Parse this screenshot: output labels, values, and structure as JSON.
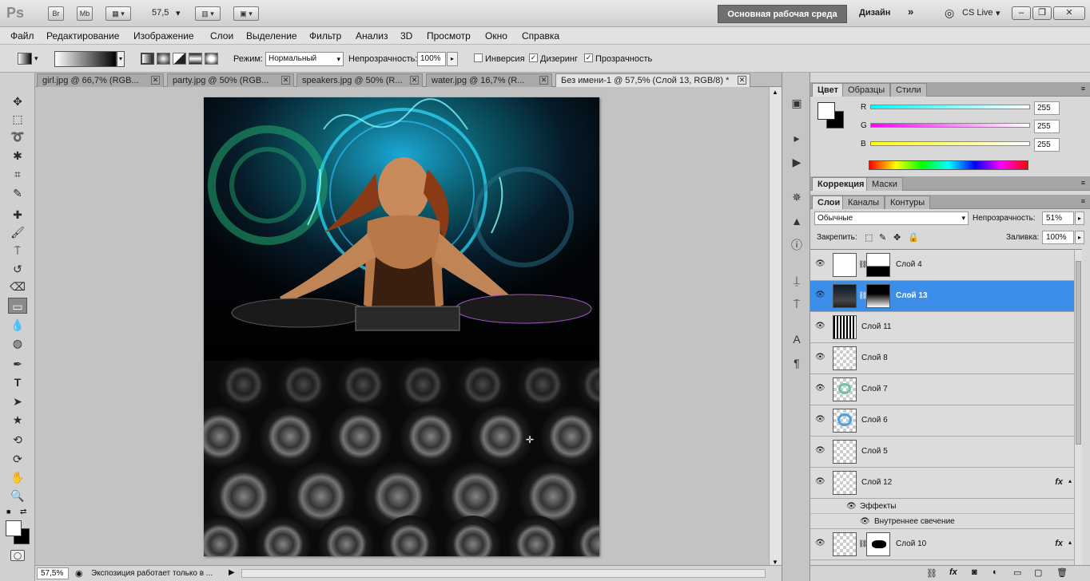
{
  "app": {
    "logo": "Ps",
    "bridge": "Br",
    "minibridge": "Mb",
    "zoom_value": "57,5",
    "workspace": "Основная рабочая среда",
    "design": "Дизайн",
    "more": "»",
    "cslive": "CS Live"
  },
  "window_controls": {
    "minimize": "–",
    "restore": "❐",
    "close": "✕"
  },
  "menu": [
    "Файл",
    "Редактирование",
    "Изображение",
    "Слои",
    "Выделение",
    "Фильтр",
    "Анализ",
    "3D",
    "Просмотр",
    "Окно",
    "Справка"
  ],
  "options": {
    "mode_label": "Режим:",
    "mode_value": "Нормальный",
    "opacity_label": "Непрозрачность:",
    "opacity_value": "100%",
    "invert_label": "Инверсия",
    "dither_label": "Дизеринг",
    "transparency_label": "Прозрачность"
  },
  "doc_tabs": [
    {
      "label": "girl.jpg @ 66,7% (RGB..."
    },
    {
      "label": "party.jpg @ 50% (RGB..."
    },
    {
      "label": "speakers.jpg @ 50% (R..."
    },
    {
      "label": "water.jpg @ 16,7% (R..."
    },
    {
      "label": "Без имени-1 @ 57,5% (Слой 13, RGB/8) *"
    }
  ],
  "status": {
    "zoom": "57,5%",
    "message": "Экспозиция работает только в ..."
  },
  "color_panel": {
    "tabs": [
      "Цвет",
      "Образцы",
      "Стили"
    ],
    "r_label": "R",
    "g_label": "G",
    "b_label": "B",
    "r": "255",
    "g": "255",
    "b": "255"
  },
  "adjust_panel": {
    "tabs": [
      "Коррекция",
      "Маски"
    ]
  },
  "layers_panel": {
    "tabs": [
      "Слои",
      "Каналы",
      "Контуры"
    ],
    "blend_mode": "Обычные",
    "opacity_label": "Непрозрачность:",
    "opacity_value": "51%",
    "lock_label": "Закрепить:",
    "fill_label": "Заливка:",
    "fill_value": "100%",
    "effects_label": "Эффекты",
    "inner_glow_label": "Внутреннее свечение",
    "fx": "fx",
    "layers": [
      {
        "name": "Слой 4"
      },
      {
        "name": "Слой 13"
      },
      {
        "name": "Слой 11"
      },
      {
        "name": "Слой 8"
      },
      {
        "name": "Слой 7"
      },
      {
        "name": "Слой 6"
      },
      {
        "name": "Слой 5"
      },
      {
        "name": "Слой 12"
      },
      {
        "name": "Слой 10"
      }
    ]
  },
  "colors": {
    "accent": "#3d8ee8",
    "selected_layer": "#3d8ee8",
    "workspace_button": "#6f6f6f"
  }
}
